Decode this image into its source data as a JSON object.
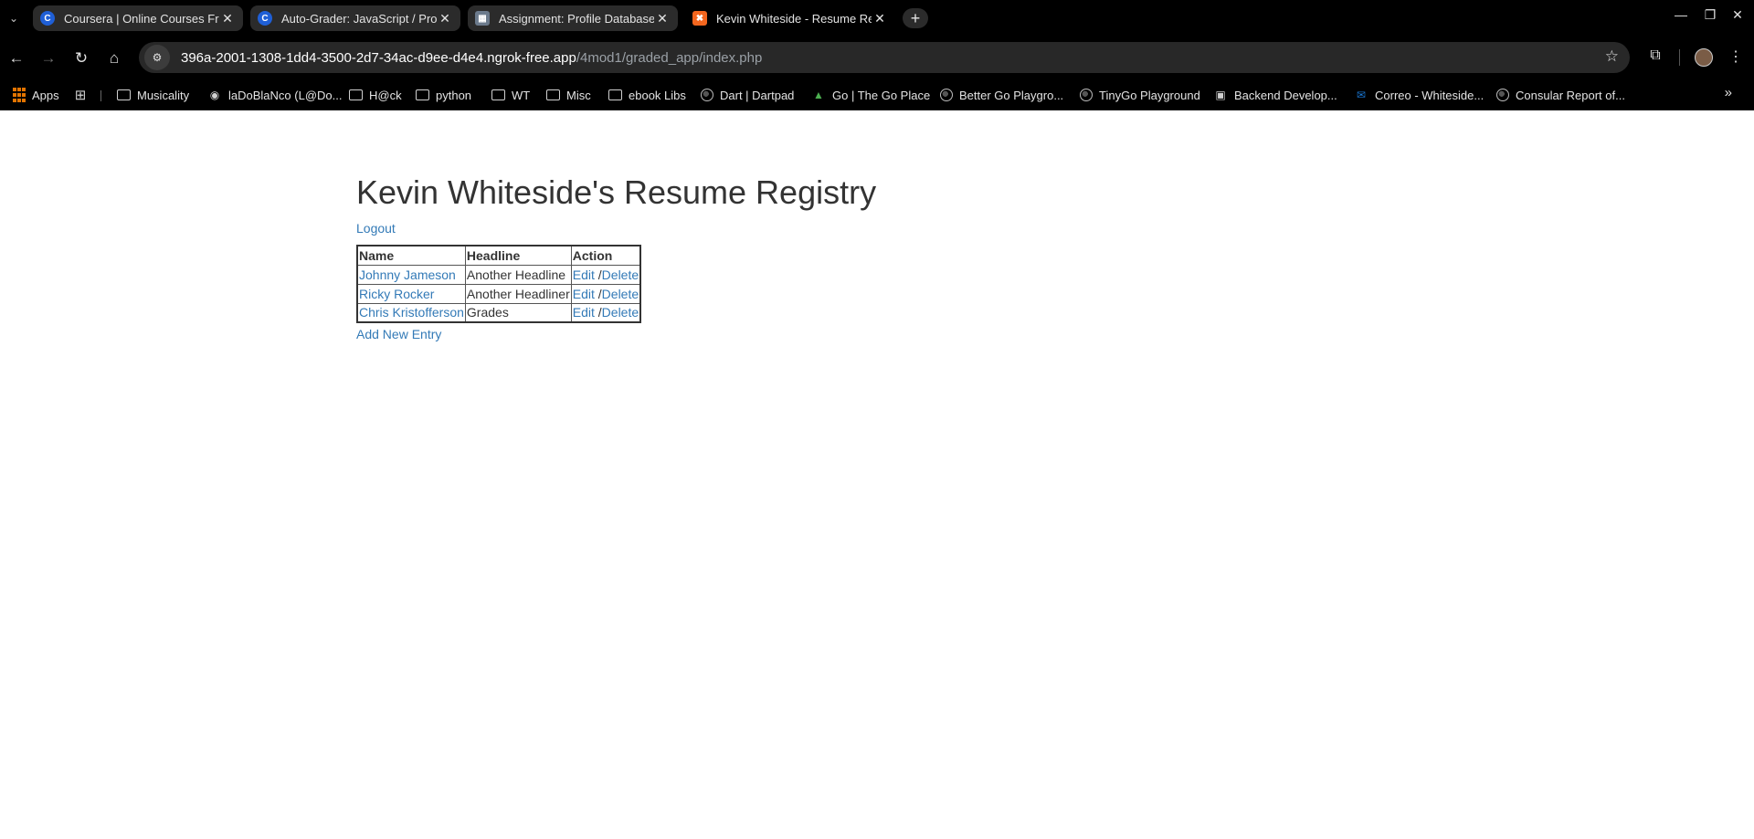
{
  "browser": {
    "tabs": [
      {
        "title": "Coursera | Online Courses Fro",
        "icon": "coursera-icon"
      },
      {
        "title": "Auto-Grader: JavaScript / Prof",
        "icon": "coursera-icon"
      },
      {
        "title": "Assignment: Profile Database",
        "icon": "assignment-icon"
      },
      {
        "title": "Kevin Whiteside - Resume Reg",
        "icon": "xampp-icon"
      }
    ],
    "url_host": "396a-2001-1308-1dd4-3500-2d7-34ac-d9ee-d4e4.ngrok-free.app",
    "url_path": "/4mod1/graded_app/index.php",
    "bookmarks": [
      {
        "label": "Apps",
        "icon": "apps-icon"
      },
      {
        "label": "Musicality",
        "icon": "folder-icon"
      },
      {
        "label": "laDoBlaNco (L@Do...",
        "icon": "github-icon"
      },
      {
        "label": "H@ck",
        "icon": "folder-icon"
      },
      {
        "label": "python",
        "icon": "folder-icon"
      },
      {
        "label": "WT",
        "icon": "folder-icon"
      },
      {
        "label": "Misc",
        "icon": "folder-icon"
      },
      {
        "label": "ebook Libs",
        "icon": "folder-icon"
      },
      {
        "label": "Dart | Dartpad",
        "icon": "globe-icon"
      },
      {
        "label": "Go | The Go Place",
        "icon": "go-icon"
      },
      {
        "label": "Better Go Playgro...",
        "icon": "globe-icon"
      },
      {
        "label": "TinyGo Playground",
        "icon": "globe-icon"
      },
      {
        "label": "Backend Develop...",
        "icon": "backend-icon"
      },
      {
        "label": "Correo - Whiteside...",
        "icon": "outlook-icon"
      },
      {
        "label": "Consular Report of...",
        "icon": "globe-icon"
      }
    ]
  },
  "page": {
    "heading": "Kevin Whiteside's Resume Registry",
    "logout": "Logout",
    "table": {
      "headers": [
        "Name",
        "Headline",
        "Action"
      ],
      "rows": [
        {
          "name": "Johnny Jameson",
          "headline": "Another Headline",
          "edit": "Edit",
          "sep": " /",
          "delete": "Delete"
        },
        {
          "name": "Ricky Rocker",
          "headline": "Another Headliner",
          "edit": "Edit",
          "sep": " /",
          "delete": "Delete"
        },
        {
          "name": "Chris Kristofferson",
          "headline": "Grades",
          "edit": "Edit",
          "sep": " /",
          "delete": "Delete"
        }
      ]
    },
    "add_new": "Add New Entry"
  },
  "colors": {
    "link": "#337ab7",
    "text": "#333333",
    "chrome_bg": "#000000"
  }
}
